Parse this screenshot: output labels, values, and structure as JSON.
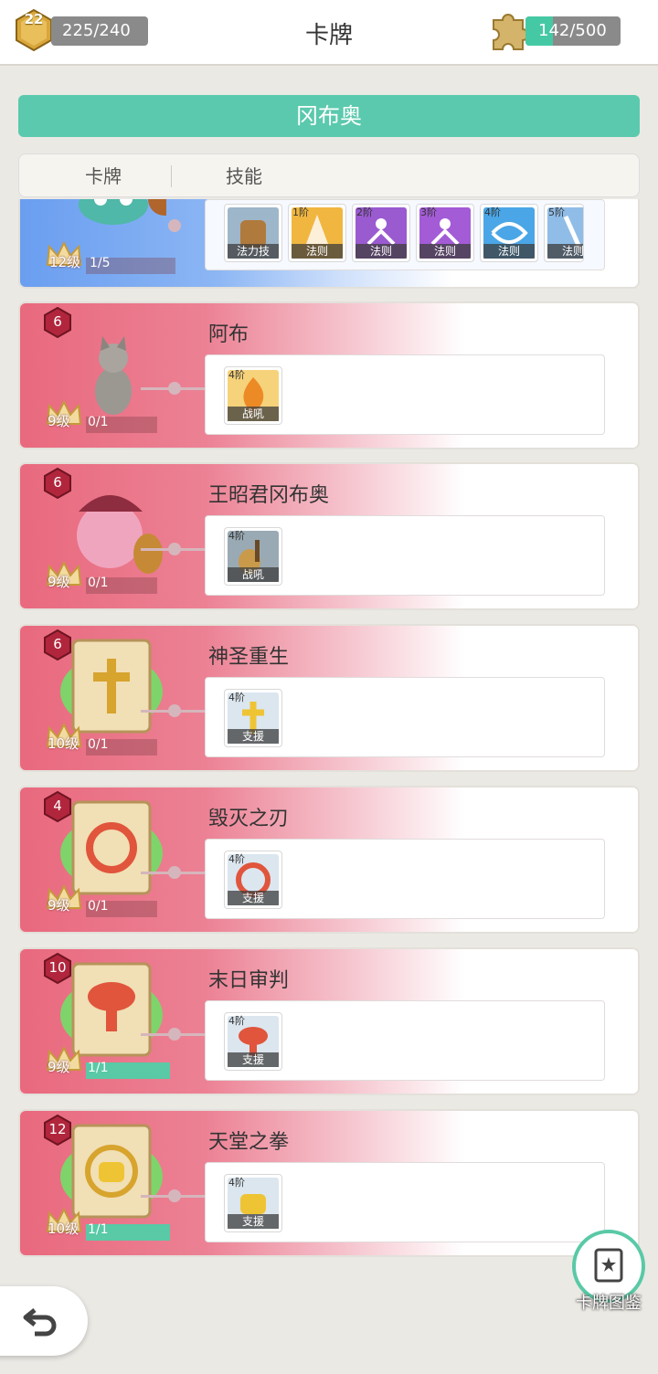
{
  "topbar": {
    "player_level": "22",
    "xp": "225/240",
    "title": "卡牌",
    "fragments": "142/500",
    "fragments_fraction": 0.284
  },
  "banner": {
    "label": "冈布奥"
  },
  "tabs": [
    {
      "label": "卡牌"
    },
    {
      "label": "技能"
    }
  ],
  "cards": [
    {
      "name": "",
      "level": "12级",
      "count": "1/5",
      "skills": [
        {
          "tier": "",
          "type": "法力技",
          "icon": "backpack-icon"
        },
        {
          "tier": "1阶",
          "type": "法则",
          "icon": "flame-rune-icon"
        },
        {
          "tier": "2阶",
          "type": "法则",
          "icon": "figure-rune-icon"
        },
        {
          "tier": "3阶",
          "type": "法则",
          "icon": "figure-rune-icon"
        },
        {
          "tier": "4阶",
          "type": "法则",
          "icon": "wave-rune-icon"
        },
        {
          "tier": "5阶",
          "type": "法则",
          "icon": "sword-rune-icon"
        }
      ]
    },
    {
      "rarity": "6",
      "name": "阿布",
      "level": "9级",
      "count": "0/1",
      "full": false,
      "skills": [
        {
          "tier": "4阶",
          "type": "战吼",
          "icon": "fire-icon"
        }
      ]
    },
    {
      "rarity": "6",
      "name": "王昭君冈布奥",
      "level": "9级",
      "count": "0/1",
      "full": false,
      "skills": [
        {
          "tier": "4阶",
          "type": "战吼",
          "icon": "lute-icon"
        }
      ]
    },
    {
      "rarity": "6",
      "name": "神圣重生",
      "level": "10级",
      "count": "0/1",
      "full": false,
      "skills": [
        {
          "tier": "4阶",
          "type": "支援",
          "icon": "holy-cross-icon"
        }
      ]
    },
    {
      "rarity": "4",
      "name": "毁灭之刃",
      "level": "9级",
      "count": "0/1",
      "full": false,
      "skills": [
        {
          "tier": "4阶",
          "type": "支援",
          "icon": "blade-icon"
        }
      ]
    },
    {
      "rarity": "10",
      "name": "末日审判",
      "level": "9级",
      "count": "1/1",
      "full": true,
      "skills": [
        {
          "tier": "4阶",
          "type": "支援",
          "icon": "mushroom-cloud-icon"
        }
      ]
    },
    {
      "rarity": "12",
      "name": "天堂之拳",
      "level": "10级",
      "count": "1/1",
      "full": true,
      "skills": [
        {
          "tier": "4阶",
          "type": "支援",
          "icon": "fist-icon"
        }
      ]
    }
  ],
  "guide": {
    "label": "卡牌图鉴"
  },
  "colors": {
    "accent": "#5bc9ad",
    "card_red": "#e9697e",
    "card_blue": "#6a9ef0"
  }
}
